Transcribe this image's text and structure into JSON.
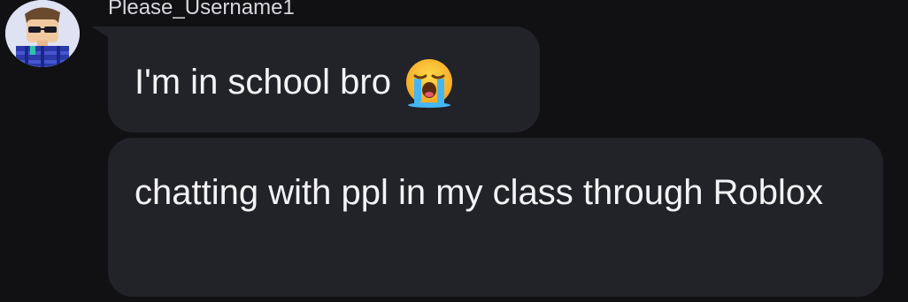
{
  "message_group": {
    "username": "Please_Username1",
    "messages": [
      {
        "text": "I'm in school bro",
        "emoji": "loudly-crying-face-icon"
      },
      {
        "text": "chatting with ppl in my class through Roblox"
      }
    ]
  },
  "colors": {
    "background": "#111114",
    "bubble": "#222328",
    "text": "#f3f3f5",
    "username": "#d6d7dc"
  }
}
